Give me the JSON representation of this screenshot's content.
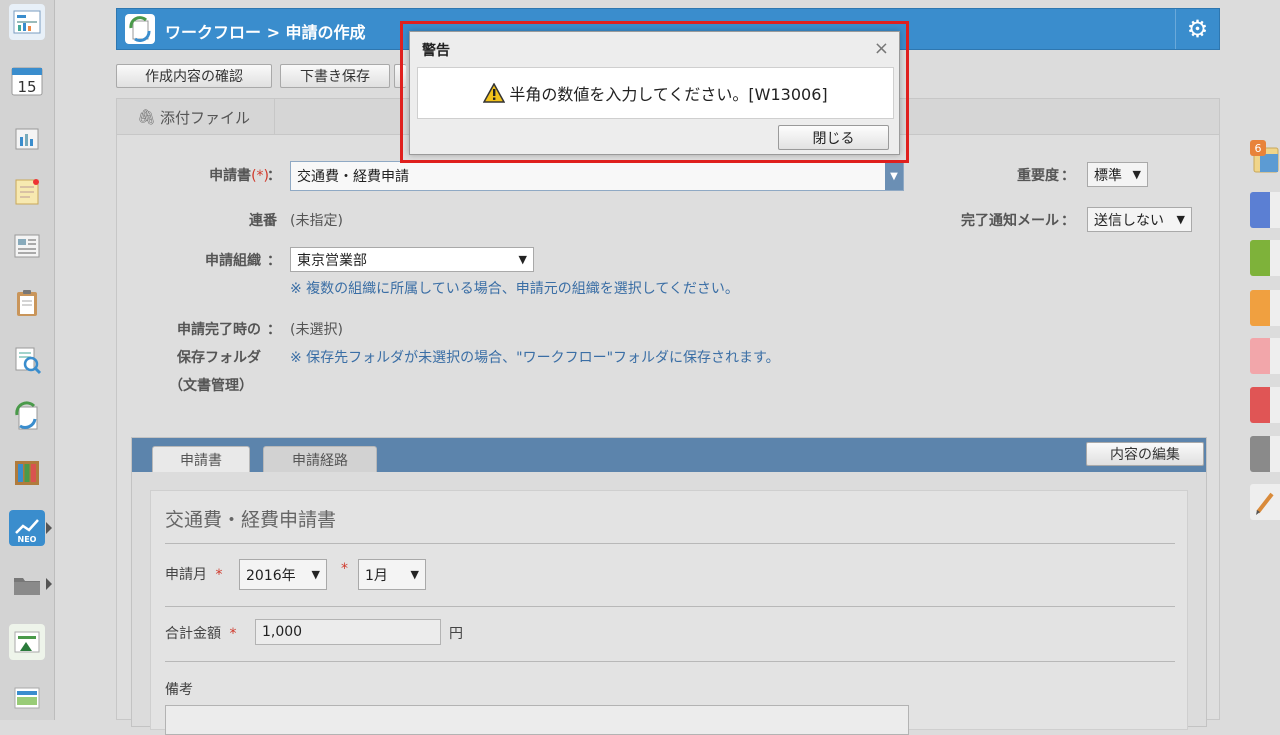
{
  "header": {
    "title": "ワークフロー > 申請の作成"
  },
  "toolbar": {
    "confirm_label": "作成内容の確認",
    "draft_label": "下書き保存"
  },
  "attachment": {
    "label": "添付ファイル"
  },
  "form": {
    "application_label": "申請書",
    "application_required": "(*)",
    "colon": "：",
    "application_value": "交通費・経費申請",
    "serial_label": "連番",
    "serial_value": "(未指定)",
    "org_label": "申請組織",
    "org_value": "東京営業部",
    "org_note": "※ 複数の組織に所属している場合、申請元の組織を選択してください。",
    "folder_label_1": "申請完了時の",
    "folder_label_2": "保存フォルダ",
    "folder_label_3": "（文書管理）",
    "folder_value": "(未選択)",
    "folder_note": "※ 保存先フォルダが未選択の場合、\"ワークフロー\"フォルダに保存されます。",
    "priority_label": "重要度",
    "priority_value": "標準",
    "mail_label": "完了通知メール",
    "mail_value": "送信しない"
  },
  "tabs": {
    "sheet": "申請書",
    "route": "申請経路",
    "edit_button": "内容の編集"
  },
  "sheet": {
    "title": "交通費・経費申請書",
    "month_label": "申請月",
    "required_mark": "*",
    "year_value": "2016年",
    "month_value": "1月",
    "total_label": "合計金額",
    "total_value": "1,000",
    "total_unit": "円",
    "remarks_label": "備考"
  },
  "dialog": {
    "title": "警告",
    "message": "半角の数値を入力してください。[W13006]",
    "close_label": "閉じる",
    "close_x": "×"
  },
  "sidebar": {
    "calendar_day": "15",
    "neo_label": "NEO",
    "notification_count": "6"
  },
  "colors": {
    "header_blue": "#3a8dcd",
    "tab_bar": "#5c84ac",
    "note_blue": "#3a6ea5",
    "highlight_red": "#e0201e"
  }
}
